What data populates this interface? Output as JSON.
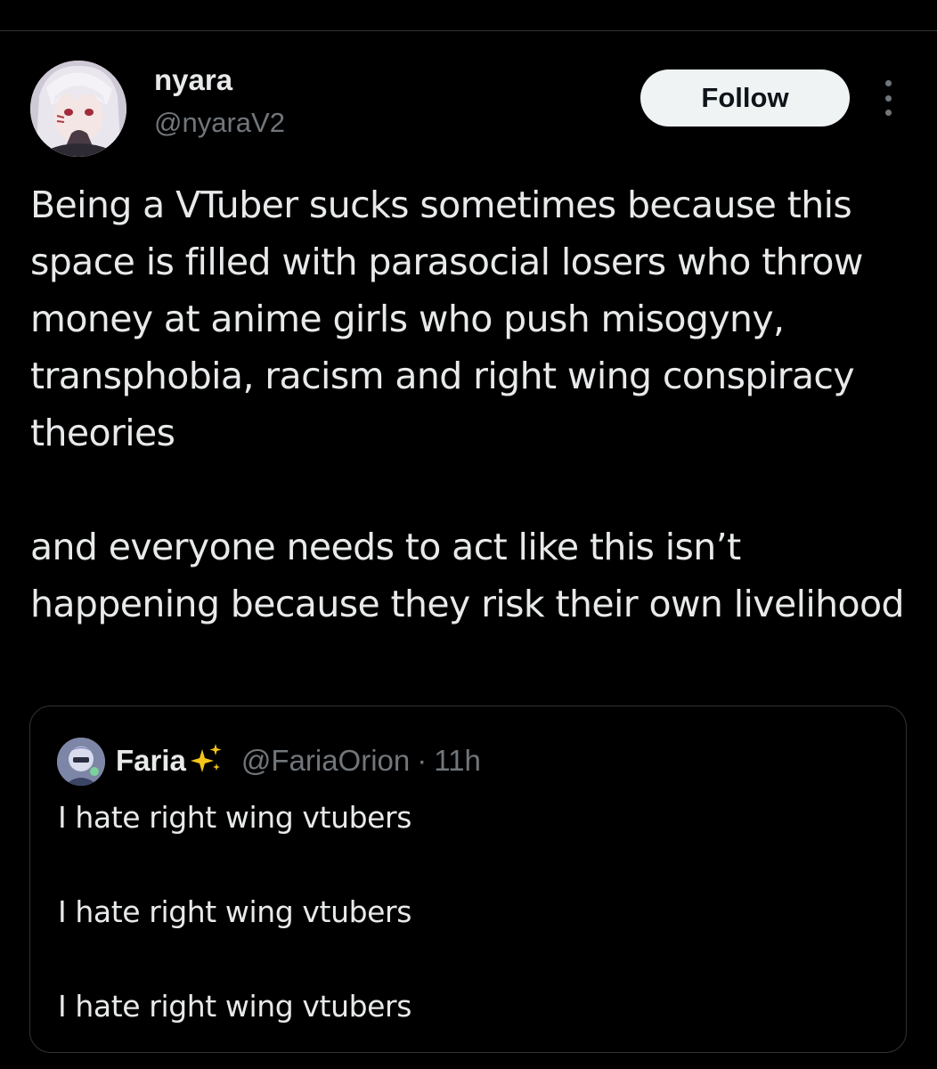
{
  "author": {
    "display_name": "nyara",
    "handle": "@nyaraV2",
    "avatar_icon": "avatar-anime-girl"
  },
  "actions": {
    "follow_label": "Follow",
    "more_icon": "more-vertical-icon"
  },
  "tweet": {
    "paragraphs": [
      "Being a VTuber sucks sometimes because this space is filled with parasocial losers who throw money at anime girls who push misogyny, transphobia, racism and right wing conspiracy theories",
      "and everyone needs to act like this isn’t happening because they risk their own livelihood"
    ]
  },
  "quote": {
    "display_name": "Faria",
    "name_emoji": "sparkles-icon",
    "handle": "@FariaOrion",
    "separator": "·",
    "time": "11h",
    "lines": [
      "I hate right wing vtubers",
      "I hate right wing vtubers",
      "I hate right wing vtubers"
    ]
  },
  "colors": {
    "background": "#000000",
    "primary_text": "#e7e9ea",
    "secondary_text": "#71767b",
    "border": "#2f3336",
    "follow_bg": "#eff3f4"
  }
}
